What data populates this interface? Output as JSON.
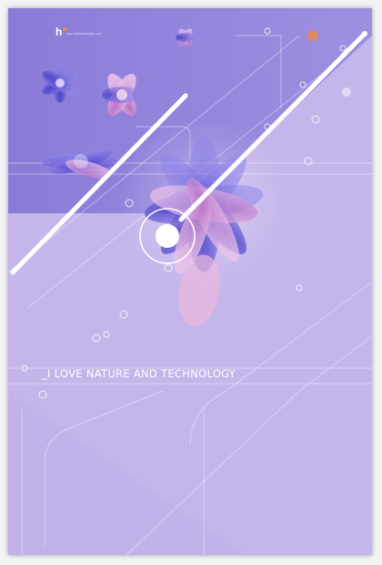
{
  "poster": {
    "brand_mark": "h",
    "brand_text": "www.whitewolfstudio.com",
    "tagline": "_I LOVE NATURE AND TECHNOLOGY"
  },
  "colors": {
    "page_bg": "#f3f3f5",
    "poster_bg": "#c2b2ea",
    "top_band": "#8b7dd8",
    "flower_blue": "#5a4fd0",
    "flower_pink": "#e5a7d6",
    "accent_orange": "#f08a3c",
    "line": "#ffffff"
  }
}
